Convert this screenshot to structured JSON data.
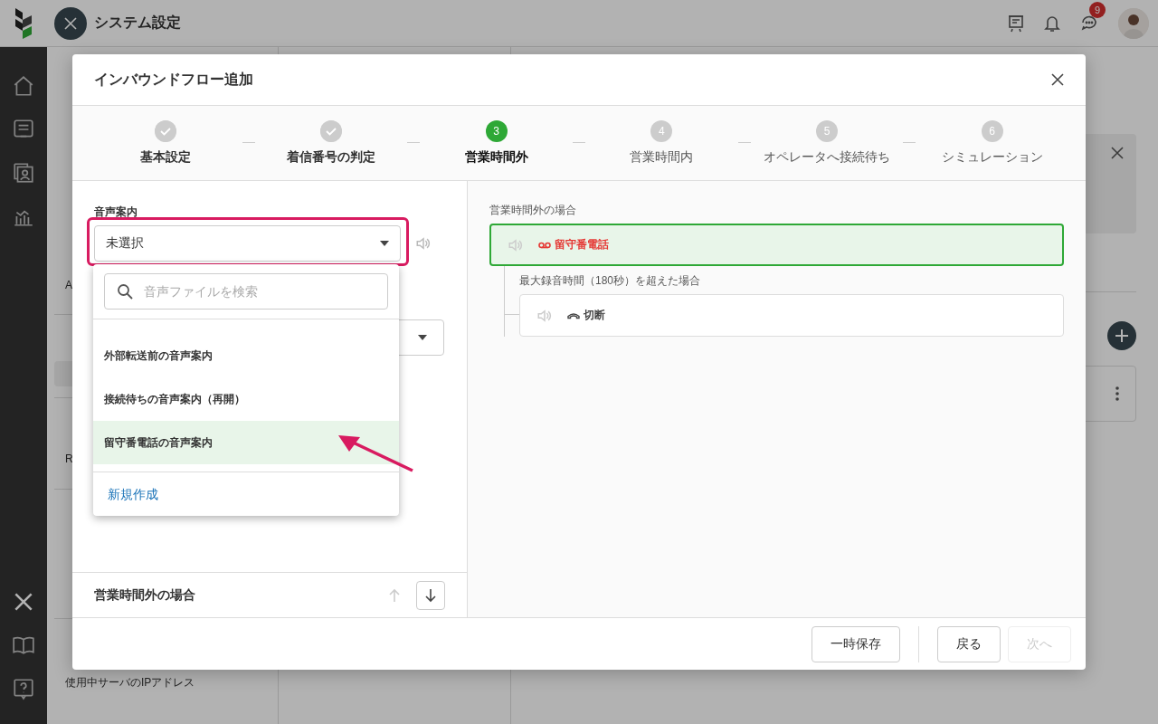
{
  "app_header": {
    "title": "システム設定",
    "notification_badge": "9"
  },
  "settings_menu": {
    "items": [
      {
        "text": "A"
      },
      {
        "text": "R"
      },
      {
        "text": "使用中サーバのIPアドレス"
      }
    ]
  },
  "modal": {
    "title": "インバウンドフロー追加",
    "steps": [
      {
        "label": "基本設定",
        "completed": true,
        "selected": false
      },
      {
        "label": "着信番号の判定",
        "completed": true,
        "selected": false
      },
      {
        "number": "3",
        "label": "営業時間外",
        "completed": false,
        "selected": true
      },
      {
        "number": "4",
        "label": "営業時間内",
        "completed": false,
        "selected": false
      },
      {
        "number": "5",
        "label": "オペレータへ接続待ち",
        "completed": false,
        "selected": false
      },
      {
        "number": "6",
        "label": "シミュレーション",
        "completed": false,
        "selected": false
      }
    ],
    "left_panel": {
      "field_label": "音声案内",
      "select": {
        "value": "未選択",
        "highlighted": true
      },
      "dropdown": {
        "search_placeholder": "音声ファイルを検索",
        "options": [
          {
            "label": "外部転送前の音声案内",
            "selected": false
          },
          {
            "label": "接続待ちの音声案内（再開）",
            "selected": false
          },
          {
            "label": "留守番電話の音声案内",
            "selected": true
          }
        ],
        "create_link": "新規作成"
      },
      "section_title": "営業時間外の場合",
      "move_up_disabled": true,
      "move_down_disabled": false
    },
    "right_panel": {
      "flow_label": "営業時間外の場合",
      "primary_node": {
        "kind": "voicemail",
        "label": "留守番電話",
        "selected": true
      },
      "branch": {
        "condition": "最大録音時間（180秒）を超えた場合",
        "node": {
          "kind": "hangup",
          "label": "切断",
          "selected": false
        }
      }
    },
    "footer_buttons": [
      {
        "label": "一時保存",
        "disabled": false
      },
      {
        "label": "戻る",
        "disabled": false
      },
      {
        "label": "次へ",
        "disabled": true
      }
    ]
  }
}
